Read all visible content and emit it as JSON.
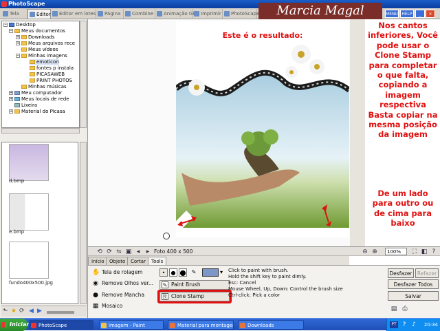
{
  "window": {
    "title": "PhotoScape"
  },
  "tabs": [
    {
      "label": "Tela"
    },
    {
      "label": "Editor"
    },
    {
      "label": "Editor em lotes"
    },
    {
      "label": "Página"
    },
    {
      "label": "Combine"
    },
    {
      "label": "Animação Gif"
    },
    {
      "label": "Imprimir"
    },
    {
      "label": "PhotoScape"
    }
  ],
  "brand": {
    "text": "Marcia Magal Scraps"
  },
  "top_buttons": {
    "menu": "MENU",
    "help": "HELP"
  },
  "tree": [
    {
      "label": "Desktop"
    },
    {
      "label": "Meus documentos"
    },
    {
      "label": "Downloads"
    },
    {
      "label": "Meus arquivos rece"
    },
    {
      "label": "Meus vídeos"
    },
    {
      "label": "Minhas imagens"
    },
    {
      "label": "emoticon"
    },
    {
      "label": "fontes p instala"
    },
    {
      "label": "PICASAWEB"
    },
    {
      "label": "PRINT PHOTOS"
    },
    {
      "label": "Minhas músicas"
    },
    {
      "label": "Meu computador"
    },
    {
      "label": "Meus locais de rede"
    },
    {
      "label": "Lixeira"
    },
    {
      "label": "Material do Picasa"
    }
  ],
  "thumbnails": [
    {
      "label": "d.bmp"
    },
    {
      "label": "e.bmp"
    },
    {
      "label": "fundo400x500.jpg"
    }
  ],
  "canvas": {
    "result_title": "Este é o resultado:"
  },
  "notes": {
    "main": "Nos cantos inferiores, Você pode usar o Clone Stamp para completar o que falta, copiando a imagem respectiva Basta copiar na mesma posição da imagem",
    "secondary": "De um lado para outro ou de cima para baixo"
  },
  "toolbar": {
    "photo_size": "Foto 400 x 500",
    "zoom": "100%"
  },
  "editor_tabs": [
    {
      "label": "Início"
    },
    {
      "label": "Objeto"
    },
    {
      "label": "Cortar"
    },
    {
      "label": "Tools"
    }
  ],
  "tools": {
    "scroll": "Tela de rolagem",
    "red_eye": "Remove Olhos ver...",
    "remove_stain": "Remove Mancha",
    "mosaic": "Mosaico",
    "paint_brush": "Paint Brush",
    "clone_stamp": "Clone Stamp"
  },
  "help_text": [
    "Click to paint with brush.",
    "Hold the shift key to paint dimly.",
    "Esc: Cancel",
    "Mouse Wheel, Up, Down: Control the brush size",
    "Ctrl-click: Pick a color"
  ],
  "colors": {
    "brush_color": "#7d97c9",
    "highlight": "#e01010",
    "note_text": "#e01010"
  },
  "buttons": {
    "undo": "Desfazer",
    "redo": "Refazer",
    "undo_all": "Desfazer Todos",
    "save": "Salvar"
  },
  "taskbar": {
    "start": "Iniciar",
    "items": [
      {
        "label": "PhotoScape"
      },
      {
        "label": "imagem - Paint"
      },
      {
        "label": "Material para montagens..."
      },
      {
        "label": "Downloads"
      }
    ],
    "lang": "PT",
    "clock": "20:34"
  }
}
